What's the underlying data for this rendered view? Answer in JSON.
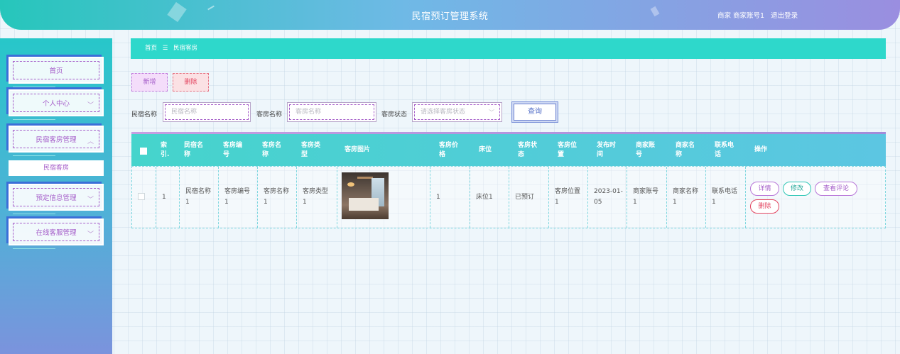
{
  "header": {
    "title": "民宿预订管理系统",
    "user_label": "商家 商家账号1",
    "logout": "退出登录"
  },
  "sidebar": {
    "items": [
      {
        "label": "首页"
      },
      {
        "label": "个人中心"
      },
      {
        "label": "民宿客房管理"
      },
      {
        "label": "预定信息管理"
      },
      {
        "label": "在线客服管理"
      }
    ],
    "sub_item": "民宿客房"
  },
  "breadcrumb": {
    "home": "首页",
    "separator": "☰",
    "current": "民宿客房"
  },
  "toolbar": {
    "add_label": "新增",
    "delete_label": "删除"
  },
  "search": {
    "field1_label": "民宿名称",
    "field1_placeholder": "民宿名称",
    "field2_label": "客房名称",
    "field2_placeholder": "客房名称",
    "field3_label": "客房状态",
    "field3_placeholder": "请选择客房状态",
    "query_label": "查询"
  },
  "table": {
    "headers": [
      "索引",
      "民宿名称",
      "客房编号",
      "客房名称",
      "客房类型",
      "客房图片",
      "客房价格",
      "床位",
      "客房状态",
      "客房位置",
      "发布时间",
      "商家账号",
      "商家名称",
      "联系电话",
      "操作"
    ],
    "header_lines": [
      [
        "索",
        "引."
      ],
      [
        "民宿名",
        "称"
      ],
      [
        "客房编",
        "号"
      ],
      [
        "客房名",
        "称"
      ],
      [
        "客房类",
        "型"
      ],
      [
        "客房图片"
      ],
      [
        "客房价",
        "格"
      ],
      [
        "床位"
      ],
      [
        "客房状",
        "态"
      ],
      [
        "客房位",
        "置"
      ],
      [
        "发布时",
        "间"
      ],
      [
        "商家账",
        "号"
      ],
      [
        "商家名",
        "称"
      ],
      [
        "联系电",
        "话"
      ],
      [
        "操作"
      ]
    ],
    "rows": [
      {
        "index": "1",
        "homestay_name": [
          "民宿名称",
          "1"
        ],
        "room_no": [
          "客房编号",
          "1"
        ],
        "room_name": [
          "客房名称",
          "1"
        ],
        "room_type": [
          "客房类型",
          "1"
        ],
        "price": "1",
        "bed": "床位1",
        "status": "已预订",
        "location": [
          "客房位置",
          "1"
        ],
        "publish_time": [
          "2023-01-",
          "05"
        ],
        "merchant_account": [
          "商家账号",
          "1"
        ],
        "merchant_name": [
          "商家名称",
          "1"
        ],
        "phone": [
          "联系电话",
          "1"
        ]
      }
    ],
    "actions": {
      "detail": "详情",
      "edit": "修改",
      "review": "查看评论",
      "delete": "删除"
    }
  }
}
